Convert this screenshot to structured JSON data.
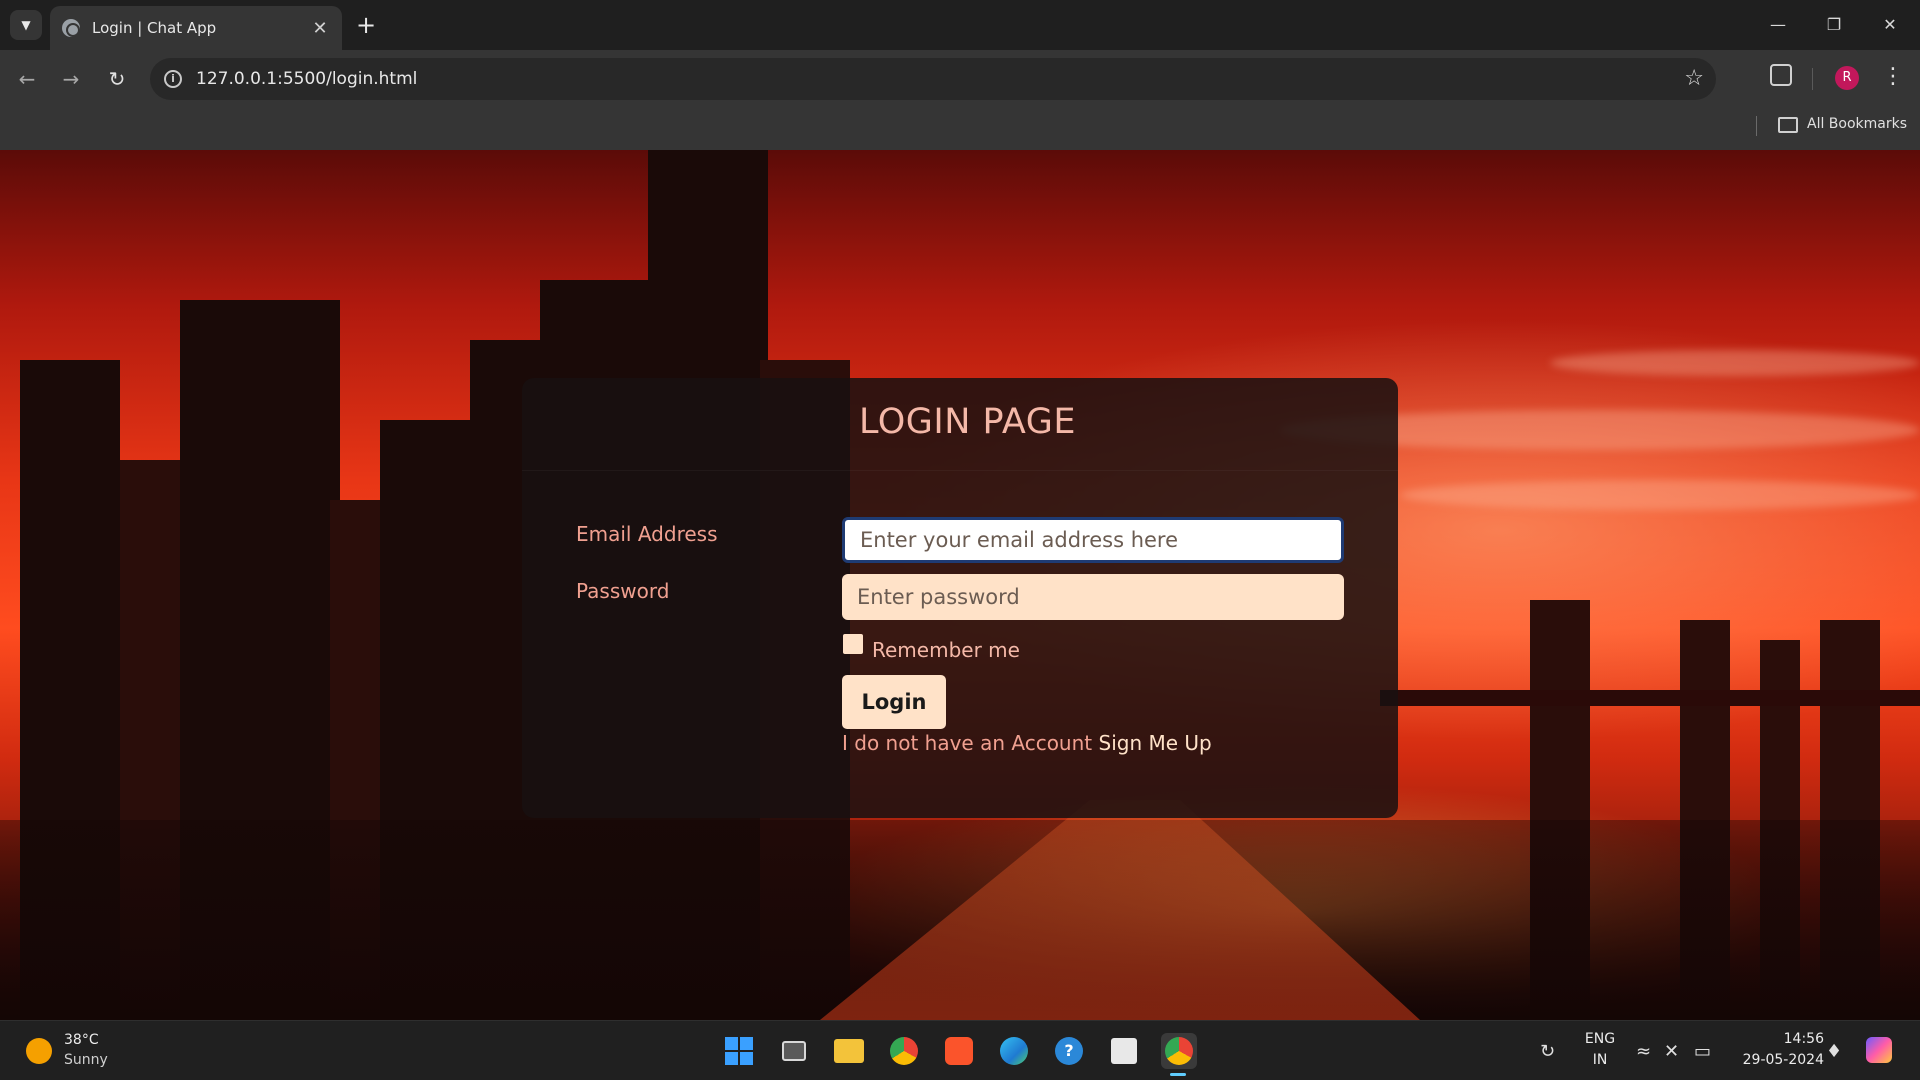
{
  "browser": {
    "tab_title": "Login | Chat App",
    "url": "127.0.0.1:5500/login.html",
    "bookmarks_label": "All Bookmarks",
    "profile_initial": "R"
  },
  "page": {
    "title": "LOGIN PAGE",
    "email_label": "Email Address",
    "email_placeholder": "Enter your email address here",
    "password_label": "Password",
    "password_placeholder": "Enter password",
    "remember_label": "Remember me",
    "login_button": "Login",
    "signup_prompt": "I do not have an Account",
    "signup_link": "Sign Me Up"
  },
  "taskbar": {
    "weather_temp": "38°C",
    "weather_desc": "Sunny",
    "language": "ENG",
    "region": "IN",
    "time": "14:56",
    "date": "29-05-2024",
    "apps": [
      "start-icon",
      "task-view-icon",
      "file-explorer-icon",
      "chrome-icon",
      "brave-icon",
      "edge-icon",
      "help-icon",
      "store-icon",
      "chrome-profile-icon"
    ]
  },
  "colors": {
    "accent_peach": "#ffe2c8",
    "label_salmon": "#f0a090",
    "card_bg": "#181010",
    "focus_border": "#1f3b73"
  }
}
